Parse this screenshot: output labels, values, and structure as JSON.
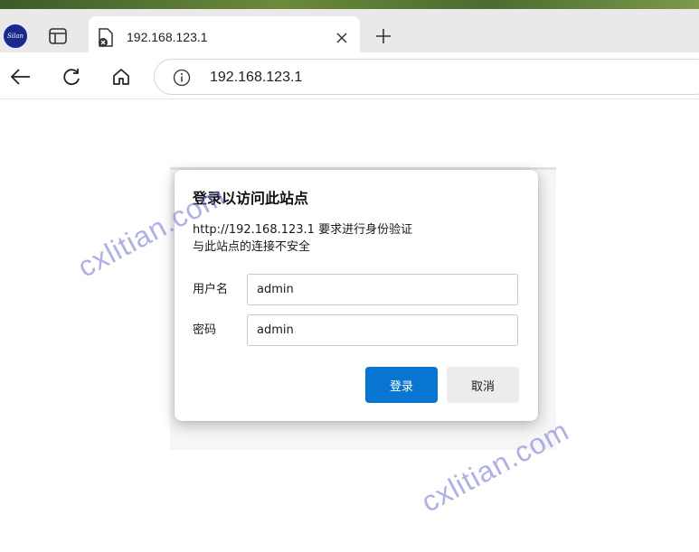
{
  "browser": {
    "tab": {
      "title": "192.168.123.1"
    },
    "address_bar": {
      "url": "192.168.123.1"
    },
    "profile": {
      "label": "Silan"
    }
  },
  "dialog": {
    "title": "登录以访问此站点",
    "message_line1": "http://192.168.123.1 要求进行身份验证",
    "message_line2": "与此站点的连接不安全",
    "username_label": "用户名",
    "username_value": "admin",
    "password_label": "密码",
    "password_value": "admin",
    "login_button": "登录",
    "cancel_button": "取消"
  },
  "watermarks": [
    "cxlitian.com",
    "cxlitian.com"
  ],
  "colors": {
    "primary_button": "#0a76d4",
    "watermark": "#6e6ed7"
  }
}
